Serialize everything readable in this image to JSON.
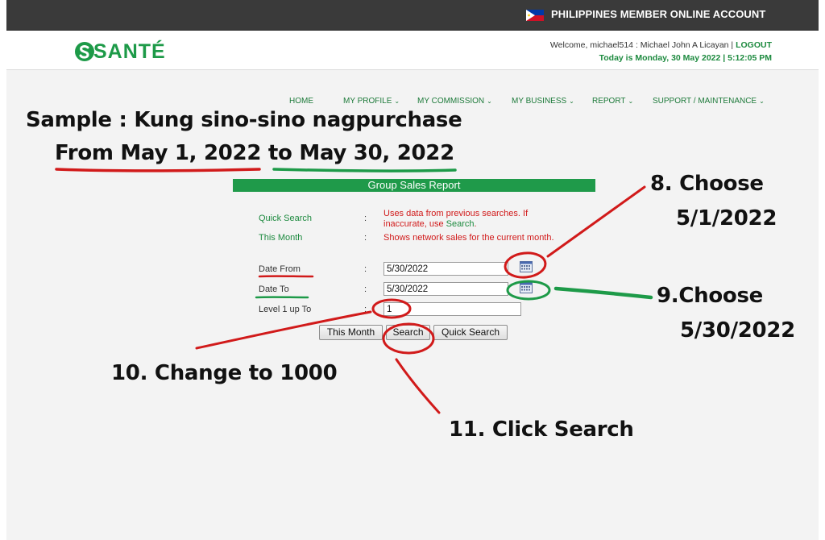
{
  "topbar": {
    "account_label": "PHILIPPINES MEMBER ONLINE ACCOUNT"
  },
  "header": {
    "logo_text": "SANTÉ",
    "welcome_prefix": "Welcome, michael514 : Michael John A Licayan | ",
    "logout": "LOGOUT",
    "today": "Today is Monday, 30 May 2022 | 5:12:05 PM"
  },
  "nav": {
    "items": [
      {
        "label": "HOME",
        "has_menu": false
      },
      {
        "label": "MY PROFILE",
        "has_menu": true
      },
      {
        "label": "MY COMMISSION",
        "has_menu": true
      },
      {
        "label": "MY BUSINESS",
        "has_menu": true
      },
      {
        "label": "REPORT",
        "has_menu": true
      },
      {
        "label": "SUPPORT / MAINTENANCE",
        "has_menu": true
      }
    ]
  },
  "annotations": {
    "sample": "Sample : Kung sino-sino nagpurchase",
    "range_from": "From May 1, 2022",
    "range_to_word": "to",
    "range_to": "May 30, 2022",
    "step8_line1": "8. Choose",
    "step8_line2": "5/1/2022",
    "step9_line1": "9.Choose",
    "step9_line2": "5/30/2022",
    "step10": "10. Change to 1000",
    "step11": "11. Click Search"
  },
  "report": {
    "title": "Group Sales Report",
    "quick_search_label": "Quick Search",
    "quick_search_desc_1": "Uses data from previous searches. If",
    "quick_search_desc_2a": "inaccurate, use ",
    "quick_search_desc_2b": "Search",
    "quick_search_desc_2c": ".",
    "this_month_label": "This Month",
    "this_month_desc": "Shows network sales for the current month.",
    "colon": ":",
    "date_from_label": "Date From",
    "date_from_value": "5/30/2022",
    "date_to_label": "Date To",
    "date_to_value": "5/30/2022",
    "level_label": "Level 1 up To",
    "level_value": "1",
    "btn_this_month": "This Month",
    "btn_search": "Search",
    "btn_quick_search": "Quick Search"
  },
  "colors": {
    "brand_green": "#1d9a48",
    "annotation_red": "#d11a1a",
    "annotation_green": "#1d9a48",
    "topbar_bg": "#3a3a3a"
  },
  "icons": [
    "philippines-flag-icon",
    "sante-logo-icon",
    "chevron-down-icon",
    "calendar-icon"
  ]
}
